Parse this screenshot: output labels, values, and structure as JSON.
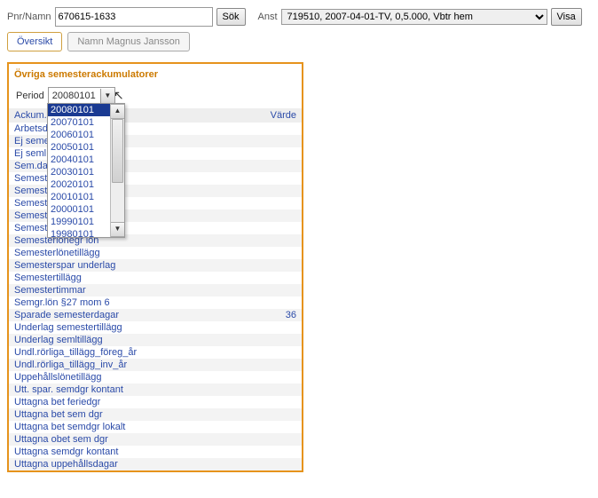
{
  "top": {
    "pnr_label": "Pnr/Namn",
    "pnr_value": "670615-1633",
    "sok_label": "Sök",
    "anst_label": "Anst",
    "anst_value": "719510, 2007-04-01-TV, 0,5.000, Vbtr hem",
    "visa_label": "Visa"
  },
  "tabs": {
    "active": "Översikt",
    "inactive": "Namn Magnus Jansson"
  },
  "panel": {
    "title": "Övriga semesterackumulatorer",
    "period_label": "Period",
    "period_selected": "20080101",
    "period_options": [
      "20080101",
      "20070101",
      "20060101",
      "20050101",
      "20040101",
      "20030101",
      "20020101",
      "20010101",
      "20000101",
      "19990101",
      "19980101"
    ],
    "header": {
      "c1": "Ackum...",
      "c2": "Värde"
    },
    "rows": [
      {
        "label": "Arbetsd",
        "value": ""
      },
      {
        "label": "Ej seme...              gr",
        "value": ""
      },
      {
        "label": "Ej seml...              n 6",
        "value": ""
      },
      {
        "label": "Sem.da",
        "value": ""
      },
      {
        "label": "Semest",
        "value": ""
      },
      {
        "label": "Semest                   gr",
        "value": ""
      },
      {
        "label": "Semest",
        "value": ""
      },
      {
        "label": "Semest                   n",
        "value": ""
      },
      {
        "label": "Semesterlön",
        "value": ""
      },
      {
        "label": "Semesterlönegr lön",
        "value": ""
      },
      {
        "label": "Semesterlönetillägg",
        "value": ""
      },
      {
        "label": "Semesterspar underlag",
        "value": ""
      },
      {
        "label": "Semestertillägg",
        "value": ""
      },
      {
        "label": "Semestertimmar",
        "value": ""
      },
      {
        "label": "Semgr.lön §27 mom 6",
        "value": ""
      },
      {
        "label": "Sparade semesterdagar",
        "value": "36"
      },
      {
        "label": "Underlag semestertillägg",
        "value": ""
      },
      {
        "label": "Underlag semltillägg",
        "value": ""
      },
      {
        "label": "Undl.rörliga_tillägg_föreg_år",
        "value": ""
      },
      {
        "label": "Undl.rörliga_tillägg_inv_år",
        "value": ""
      },
      {
        "label": "Uppehållslönetillägg",
        "value": ""
      },
      {
        "label": "Utt. spar. semdgr kontant",
        "value": ""
      },
      {
        "label": "Uttagna bet feriedgr",
        "value": ""
      },
      {
        "label": "Uttagna bet sem dgr",
        "value": ""
      },
      {
        "label": "Uttagna bet semdgr lokalt",
        "value": ""
      },
      {
        "label": "Uttagna obet sem dgr",
        "value": ""
      },
      {
        "label": "Uttagna semdgr kontant",
        "value": ""
      },
      {
        "label": "Uttagna uppehållsdagar",
        "value": ""
      }
    ]
  }
}
